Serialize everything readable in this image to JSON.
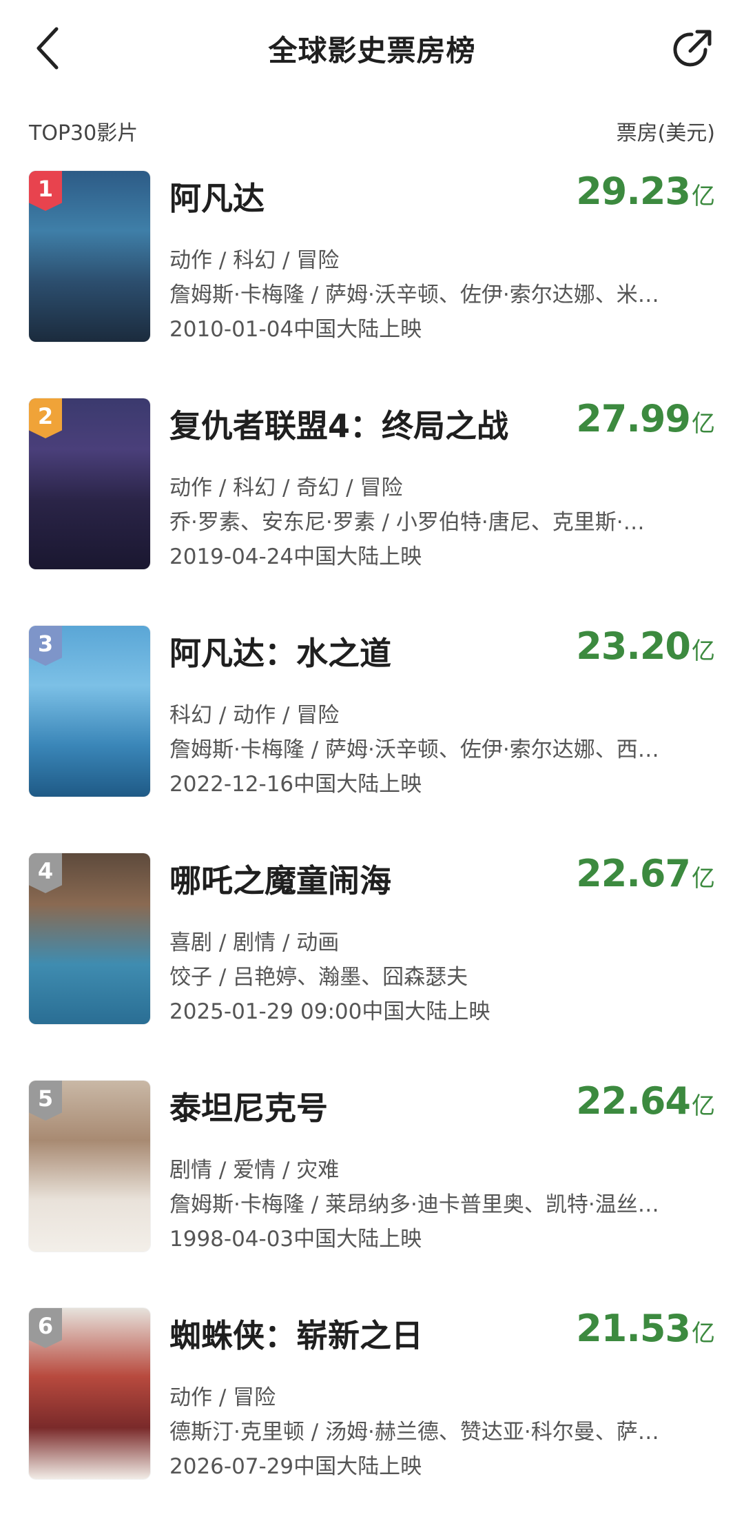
{
  "header": {
    "title": "全球影史票房榜",
    "back_icon": "chevron-left-icon",
    "share_icon": "share-icon"
  },
  "subheader": {
    "left": "TOP30影片",
    "right": "票房(美元)"
  },
  "colors": {
    "accent_green": "#3c8a3f",
    "rank1": "#e8434e",
    "rank2": "#f0a338",
    "rank3": "#7e95c9",
    "rank_other": "#9a9a9a"
  },
  "movies": [
    {
      "rank": "1",
      "title": "阿凡达",
      "box": "29.23",
      "unit": "亿",
      "genres": "动作 / 科幻 / 冒险",
      "cast": "詹姆斯·卡梅隆 / 萨姆·沃辛顿、佐伊·索尔达娜、米…",
      "release": "2010-01-04中国大陆上映"
    },
    {
      "rank": "2",
      "title": "复仇者联盟4：终局之战",
      "box": "27.99",
      "unit": "亿",
      "genres": "动作 / 科幻 / 奇幻 / 冒险",
      "cast": "乔·罗素、安东尼·罗素 / 小罗伯特·唐尼、克里斯·…",
      "release": "2019-04-24中国大陆上映"
    },
    {
      "rank": "3",
      "title": "阿凡达：水之道",
      "box": "23.20",
      "unit": "亿",
      "genres": "科幻 / 动作 / 冒险",
      "cast": "詹姆斯·卡梅隆 / 萨姆·沃辛顿、佐伊·索尔达娜、西…",
      "release": "2022-12-16中国大陆上映"
    },
    {
      "rank": "4",
      "title": "哪吒之魔童闹海",
      "box": "22.67",
      "unit": "亿",
      "genres": "喜剧 / 剧情 / 动画",
      "cast": "饺子 / 吕艳婷、瀚墨、囧森瑟夫",
      "release": "2025-01-29 09:00中国大陆上映"
    },
    {
      "rank": "5",
      "title": "泰坦尼克号",
      "box": "22.64",
      "unit": "亿",
      "genres": "剧情 / 爱情 / 灾难",
      "cast": "詹姆斯·卡梅隆 / 莱昂纳多·迪卡普里奥、凯特·温丝…",
      "release": "1998-04-03中国大陆上映"
    },
    {
      "rank": "6",
      "title": "蜘蛛侠：崭新之日",
      "box": "21.53",
      "unit": "亿",
      "genres": "动作 / 冒险",
      "cast": "德斯汀·克里顿 / 汤姆·赫兰德、赞达亚·科尔曼、萨…",
      "release": "2026-07-29中国大陆上映"
    }
  ]
}
